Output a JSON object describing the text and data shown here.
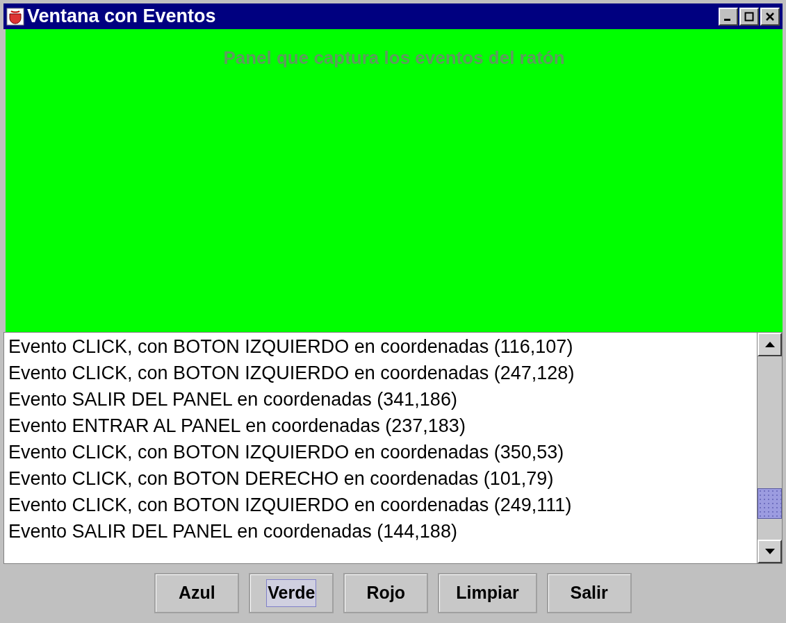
{
  "window": {
    "title": "Ventana con Eventos"
  },
  "panel": {
    "label": "Panel que captura los eventos del ratón"
  },
  "events": [
    "Evento CLICK, con BOTON IZQUIERDO en coordenadas (116,107)",
    "Evento CLICK, con BOTON IZQUIERDO en coordenadas (247,128)",
    "Evento SALIR DEL PANEL en coordenadas (341,186)",
    "Evento ENTRAR AL PANEL en coordenadas (237,183)",
    "Evento CLICK, con BOTON IZQUIERDO en coordenadas (350,53)",
    "Evento CLICK, con BOTON DERECHO en coordenadas (101,79)",
    "Evento CLICK, con BOTON IZQUIERDO en coordenadas (249,111)",
    "Evento SALIR DEL PANEL en coordenadas (144,188)"
  ],
  "buttons": [
    {
      "label": "Azul",
      "focused": false
    },
    {
      "label": "Verde",
      "focused": true
    },
    {
      "label": "Rojo",
      "focused": false
    },
    {
      "label": "Limpiar",
      "focused": false
    },
    {
      "label": "Salir",
      "focused": false
    }
  ]
}
